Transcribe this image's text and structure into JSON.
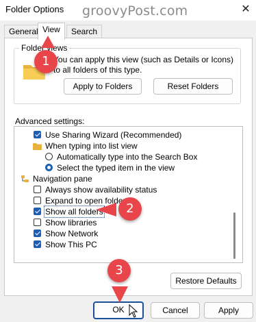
{
  "window": {
    "title": "Folder Options",
    "close_glyph": "✕"
  },
  "watermark": "groovyPost.com",
  "tabs": [
    {
      "label": "General",
      "active": false
    },
    {
      "label": "View",
      "active": true
    },
    {
      "label": "Search",
      "active": false
    }
  ],
  "folder_views": {
    "group_label": "Folder views",
    "description": "You can apply this view (such as Details or Icons) to all folders of this type.",
    "apply_button": "Apply to Folders",
    "reset_button": "Reset Folders"
  },
  "advanced": {
    "label": "Advanced settings:",
    "items": [
      {
        "type": "checkbox",
        "checked": true,
        "label": "Use Sharing Wizard (Recommended)"
      },
      {
        "type": "folder",
        "label": "When typing into list view"
      },
      {
        "type": "radio",
        "checked": false,
        "label": "Automatically type into the Search Box"
      },
      {
        "type": "radio",
        "checked": true,
        "label": "Select the typed item in the view"
      },
      {
        "type": "nav",
        "label": "Navigation pane"
      },
      {
        "type": "checkbox",
        "checked": false,
        "label": "Always show availability status"
      },
      {
        "type": "checkbox",
        "checked": false,
        "label": "Expand to open folder"
      },
      {
        "type": "checkbox",
        "checked": true,
        "label": "Show all folders"
      },
      {
        "type": "checkbox",
        "checked": false,
        "label": "Show libraries"
      },
      {
        "type": "checkbox",
        "checked": true,
        "label": "Show Network"
      },
      {
        "type": "checkbox",
        "checked": true,
        "label": "Show This PC"
      }
    ]
  },
  "restore_button": "Restore Defaults",
  "footer": {
    "ok": "OK",
    "cancel": "Cancel",
    "apply": "Apply"
  },
  "callouts": [
    "1",
    "2",
    "3"
  ],
  "colors": {
    "badge": "#e8464a",
    "accent": "#1e5fb4"
  }
}
